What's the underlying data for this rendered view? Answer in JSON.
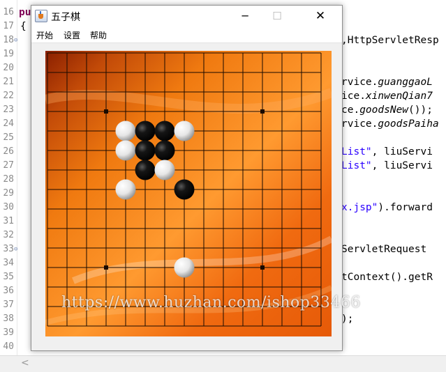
{
  "editor": {
    "line_numbers": [
      "16",
      "17",
      "18",
      "19",
      "20",
      "21",
      "22",
      "23",
      "24",
      "25",
      "26",
      "27",
      "28",
      "29",
      "30",
      "31",
      "32",
      "33",
      "34",
      "35",
      "36",
      "37",
      "38",
      "39",
      "40"
    ],
    "fold_lines": [
      "18",
      "33"
    ],
    "left_snippets": {
      "line16": "pu",
      "line17": "{"
    },
    "right_snippets": {
      "line18": ",HttpServletResp",
      "line21_a": "rvice.",
      "line21_b": "guanggaoL",
      "line22_a": "ice.",
      "line22_b": "xinwenQian7",
      "line23_a": "ce.",
      "line23_b": "goodsNew",
      "line23_c": "());",
      "line24_a": "rvice.",
      "line24_b": "goodsPaiha",
      "line26_a": "List\"",
      "line26_b": ", liuServi",
      "line27_a": "List\"",
      "line27_b": ", liuServi",
      "line30_a": "x.jsp\"",
      "line30_b": ").forward",
      "line33": "ServletRequest",
      "line35": "tContext().getR",
      "line38": ");"
    }
  },
  "window": {
    "title": "五子棋",
    "controls": {
      "minimize": "─",
      "maximize": "☐",
      "close": "✕"
    },
    "menu": {
      "start": "开始",
      "settings": "设置",
      "help": "帮助"
    }
  },
  "board": {
    "size": 15,
    "star_points": [
      [
        3,
        3
      ],
      [
        11,
        3
      ],
      [
        3,
        11
      ],
      [
        11,
        11
      ]
    ],
    "stones": [
      {
        "col": 4,
        "row": 4,
        "color": "white"
      },
      {
        "col": 5,
        "row": 4,
        "color": "black"
      },
      {
        "col": 6,
        "row": 4,
        "color": "black"
      },
      {
        "col": 7,
        "row": 4,
        "color": "white"
      },
      {
        "col": 4,
        "row": 5,
        "color": "white"
      },
      {
        "col": 5,
        "row": 5,
        "color": "black"
      },
      {
        "col": 6,
        "row": 5,
        "color": "black"
      },
      {
        "col": 5,
        "row": 6,
        "color": "black"
      },
      {
        "col": 6,
        "row": 6,
        "color": "white"
      },
      {
        "col": 4,
        "row": 7,
        "color": "white"
      },
      {
        "col": 7,
        "row": 7,
        "color": "black"
      },
      {
        "col": 7,
        "row": 11,
        "color": "white"
      }
    ],
    "colors": {
      "board_dark": "#8a1f00",
      "board_orange": "#f07a10",
      "board_light": "#ff9a30",
      "grid": "#1a0a00",
      "black_stone": "#050505",
      "white_stone": "#f2f2f2"
    }
  },
  "watermark": "https://www.huzhan.com/ishop33466"
}
